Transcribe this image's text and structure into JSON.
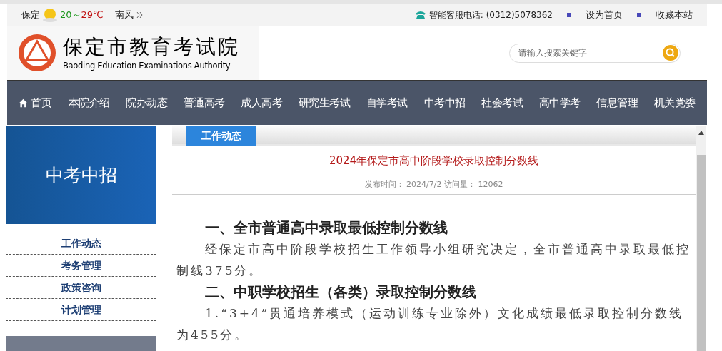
{
  "top_bar": {
    "city": "保定",
    "temp_low": "20",
    "temp_sep": "～",
    "temp_high": "29℃",
    "wind": "南风",
    "hotline": "智能客服电话: (0312)5078362",
    "links": [
      "设为首页",
      "收藏本站"
    ]
  },
  "header": {
    "logo_title": "保定市教育考试院",
    "logo_subtitle": "Baoding Education Examinations Authority",
    "search": {
      "placeholder": "请输入搜索关键字"
    }
  },
  "nav": [
    {
      "label": "首页",
      "kind": "home"
    },
    {
      "label": "本院介绍",
      "kind": "plain"
    },
    {
      "label": "院办动态",
      "kind": "plain"
    },
    {
      "label": "普通高考",
      "kind": "plain"
    },
    {
      "label": "成人高考",
      "kind": "plain"
    },
    {
      "label": "研究生考试",
      "kind": "plain"
    },
    {
      "label": "自学考试",
      "kind": "plain"
    },
    {
      "label": "中考中招",
      "kind": "plain"
    },
    {
      "label": "社会考试",
      "kind": "plain"
    },
    {
      "label": "高中学考",
      "kind": "plain"
    },
    {
      "label": "信息管理",
      "kind": "plain"
    },
    {
      "label": "机关党委",
      "kind": "plain"
    }
  ],
  "sidebar": {
    "banner": "中考中招",
    "items": [
      "工作动态",
      "考务管理",
      "政策咨询",
      "计划管理"
    ]
  },
  "article": {
    "tab": "工作动态",
    "title": "2024年保定市高中阶段学校录取控制分数线",
    "meta": "发布时间： 2024/7/2 访问量： 12062",
    "paragraphs": [
      {
        "kind": "heading",
        "text": "一、全市普通高中录取最低控制分数线"
      },
      {
        "kind": "body",
        "text": "经保定市高中阶段学校招生工作领导小组研究决定，全市普通高中录取最低控制线375分。"
      },
      {
        "kind": "heading",
        "text": "二、中职学校招生（各类）录取控制分数线"
      },
      {
        "kind": "body",
        "text": "1.“3+4”贯通培养模式（运动训练专业除外）文化成绩最低录取控制分数线为455分。"
      }
    ]
  }
}
